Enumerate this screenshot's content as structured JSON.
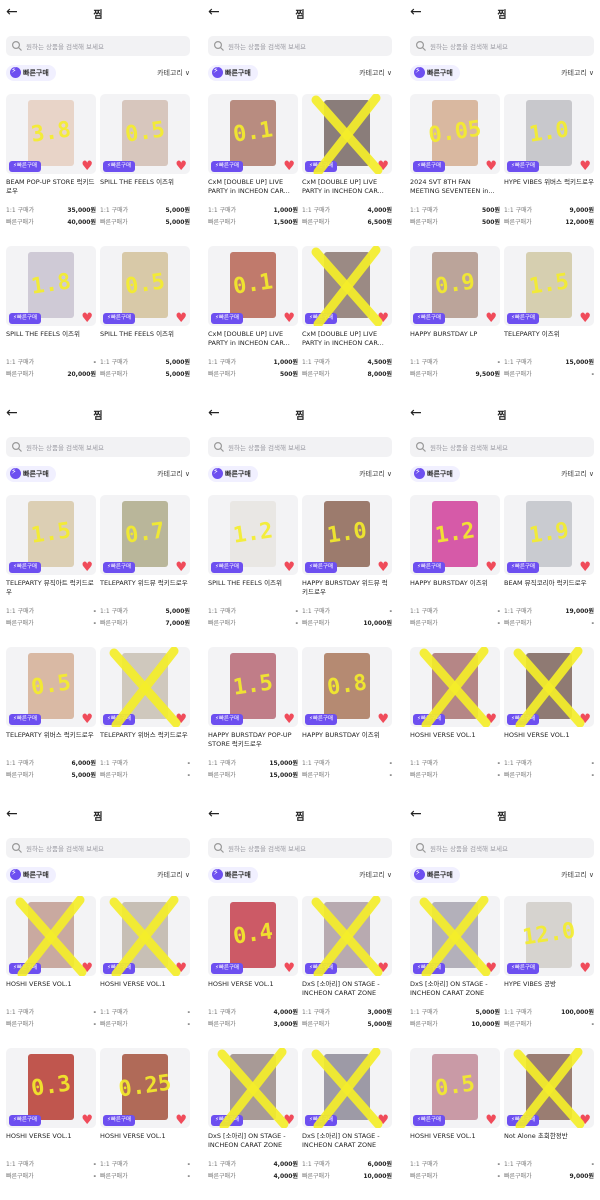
{
  "screen": {
    "title": "찜",
    "back_icon": "arrow-left-icon",
    "search_placeholder": "원하는 상품을 검색해 보세요",
    "quick_buy_label": "빠른구매",
    "category_label": "카테고리",
    "badge_label": "빠른구매",
    "price_label_1to1": "1:1 구매가",
    "price_label_quick": "빠른구매가"
  },
  "colors": {
    "accent": "#6d4ff0",
    "heart": "#f04b5a",
    "annotation": "#f5ee2a"
  },
  "panels": [
    {
      "cards": [
        {
          "name": "BEAM POP-UP STORE 럭키드로우",
          "p1": "35,000원",
          "p2": "40,000원",
          "note": "3.8",
          "x": false,
          "photo": "#e8d4c8"
        },
        {
          "name": "SPILL THE FEELS 이즈위",
          "p1": "5,000원",
          "p2": "5,000원",
          "note": "0.5",
          "x": false,
          "photo": "#d7c6bd"
        },
        {
          "name": "SPILL THE FEELS 이즈위",
          "p1": "-",
          "p2": "20,000원",
          "note": "1.8",
          "x": false,
          "photo": "#cfcad6"
        },
        {
          "name": "SPILL THE FEELS 이즈위",
          "p1": "5,000원",
          "p2": "5,000원",
          "note": "0.5",
          "x": false,
          "photo": "#d8c9a8"
        }
      ]
    },
    {
      "cards": [
        {
          "name": "CxM [DOUBLE UP] LIVE PARTY in INCHEON CAR...",
          "p1": "1,000원",
          "p2": "1,500원",
          "note": "0.1",
          "x": false,
          "photo": "#b88c80"
        },
        {
          "name": "CxM [DOUBLE UP] LIVE PARTY in INCHEON CAR...",
          "p1": "4,000원",
          "p2": "6,500원",
          "note": "",
          "x": true,
          "photo": "#8a7d7a"
        },
        {
          "name": "CxM [DOUBLE UP] LIVE PARTY in INCHEON CAR...",
          "p1": "1,000원",
          "p2": "500원",
          "note": "0.1",
          "x": false,
          "photo": "#c07a6c"
        },
        {
          "name": "CxM [DOUBLE UP] LIVE PARTY in INCHEON CAR...",
          "p1": "4,500원",
          "p2": "8,000원",
          "note": "",
          "x": true,
          "photo": "#9b8a84"
        }
      ]
    },
    {
      "cards": [
        {
          "name": "2024 SVT 8TH FAN MEETING SEVENTEEN in...",
          "p1": "500원",
          "p2": "500원",
          "note": "0.05",
          "x": false,
          "photo": "#d9b8a0"
        },
        {
          "name": "HYPE VIBES 위버스 럭키드로우",
          "p1": "9,000원",
          "p2": "12,000원",
          "note": "1.0",
          "x": false,
          "photo": "#c8c8cc"
        },
        {
          "name": "HAPPY BURSTDAY LP",
          "p1": "-",
          "p2": "9,500원",
          "note": "0.9",
          "x": false,
          "photo": "#bba49a"
        },
        {
          "name": "TELEPARTY 이즈위",
          "p1": "15,000원",
          "p2": "-",
          "note": "1.5",
          "x": false,
          "photo": "#d6cfb0"
        }
      ]
    },
    {
      "cards": [
        {
          "name": "TELEPARTY 뮤직아트 럭키드로우",
          "p1": "-",
          "p2": "-",
          "note": "1.5",
          "x": false,
          "photo": "#dccfb4"
        },
        {
          "name": "TELEPARTY 위드뮤 럭키드로우",
          "p1": "5,000원",
          "p2": "7,000원",
          "note": "0.7",
          "x": false,
          "photo": "#b9b69a"
        },
        {
          "name": "TELEPARTY 위버스 럭키드로우",
          "p1": "6,000원",
          "p2": "5,000원",
          "note": "0.5",
          "x": false,
          "photo": "#d9b9a4"
        },
        {
          "name": "TELEPARTY 위버스 럭키드로우",
          "p1": "-",
          "p2": "-",
          "note": "",
          "x": true,
          "photo": "#cfc8bd"
        }
      ]
    },
    {
      "cards": [
        {
          "name": "SPILL THE FEELS 이즈위",
          "p1": "-",
          "p2": "-",
          "note": "1.2",
          "x": false,
          "photo": "#e9e7e4"
        },
        {
          "name": "HAPPY BURSTDAY 위드뮤 럭키드로우",
          "p1": "-",
          "p2": "10,000원",
          "note": "1.0",
          "x": false,
          "photo": "#9c7b6d"
        },
        {
          "name": "HAPPY BURSTDAY POP-UP STORE 럭키드로우",
          "p1": "15,000원",
          "p2": "15,000원",
          "note": "1.5",
          "x": false,
          "photo": "#c07d88"
        },
        {
          "name": "HAPPY BURSTDAY 이즈위",
          "p1": "-",
          "p2": "-",
          "note": "0.8",
          "x": false,
          "photo": "#b58a72"
        }
      ]
    },
    {
      "cards": [
        {
          "name": "HAPPY BURSTDAY 이즈위",
          "p1": "-",
          "p2": "-",
          "note": "1.2",
          "x": false,
          "photo": "#d65aa8"
        },
        {
          "name": "BEAM 뮤직코리아 럭키드로우",
          "p1": "19,000원",
          "p2": "-",
          "note": "1.9",
          "x": false,
          "photo": "#c9cbd0"
        },
        {
          "name": "HOSHI VERSE VOL.1",
          "p1": "-",
          "p2": "-",
          "note": "",
          "x": true,
          "photo": "#b58686"
        },
        {
          "name": "HOSHI VERSE VOL.1",
          "p1": "-",
          "p2": "-",
          "note": "",
          "x": true,
          "photo": "#8f7a73"
        }
      ]
    },
    {
      "cards": [
        {
          "name": "HOSHI VERSE VOL.1",
          "p1": "-",
          "p2": "-",
          "note": "",
          "x": true,
          "photo": "#c9a9a0"
        },
        {
          "name": "HOSHI VERSE VOL.1",
          "p1": "-",
          "p2": "-",
          "note": "",
          "x": true,
          "photo": "#c7bfb5"
        },
        {
          "name": "HOSHI VERSE VOL.1",
          "p1": "-",
          "p2": "-",
          "note": "0.3",
          "x": false,
          "photo": "#c0564e"
        },
        {
          "name": "HOSHI VERSE VOL.1",
          "p1": "-",
          "p2": "-",
          "note": "0.25",
          "x": false,
          "photo": "#b06a58"
        }
      ]
    },
    {
      "cards": [
        {
          "name": "HOSHI VERSE VOL.1",
          "p1": "4,000원",
          "p2": "3,000원",
          "note": "0.4",
          "x": false,
          "photo": "#cc5a66"
        },
        {
          "name": "DxS [소아리] ON STAGE - INCHEON CARAT ZONE",
          "p1": "3,000원",
          "p2": "5,000원",
          "note": "",
          "x": true,
          "photo": "#b8aab0"
        },
        {
          "name": "DxS [소아리] ON STAGE - INCHEON CARAT ZONE",
          "p1": "4,000원",
          "p2": "4,000원",
          "note": "",
          "x": true,
          "photo": "#a89a96"
        },
        {
          "name": "DxS [소아리] ON STAGE - INCHEON CARAT ZONE",
          "p1": "6,000원",
          "p2": "10,000원",
          "note": "",
          "x": true,
          "photo": "#9d9aa6"
        }
      ]
    },
    {
      "cards": [
        {
          "name": "DxS [소아리] ON STAGE - INCHEON CARAT ZONE",
          "p1": "5,000원",
          "p2": "10,000원",
          "note": "",
          "x": true,
          "photo": "#b3b0ba"
        },
        {
          "name": "HYPE VIBES 공방",
          "p1": "100,000원",
          "p2": "-",
          "note": "12.0",
          "x": false,
          "photo": "#d6d3cf"
        },
        {
          "name": "HOSHI VERSE VOL.1",
          "p1": "-",
          "p2": "-",
          "note": "0.5",
          "x": false,
          "photo": "#c99aa6"
        },
        {
          "name": "Not Alone 초회한정반",
          "p1": "-",
          "p2": "9,000원",
          "note": "",
          "x": true,
          "photo": "#9a7d72"
        }
      ]
    }
  ]
}
